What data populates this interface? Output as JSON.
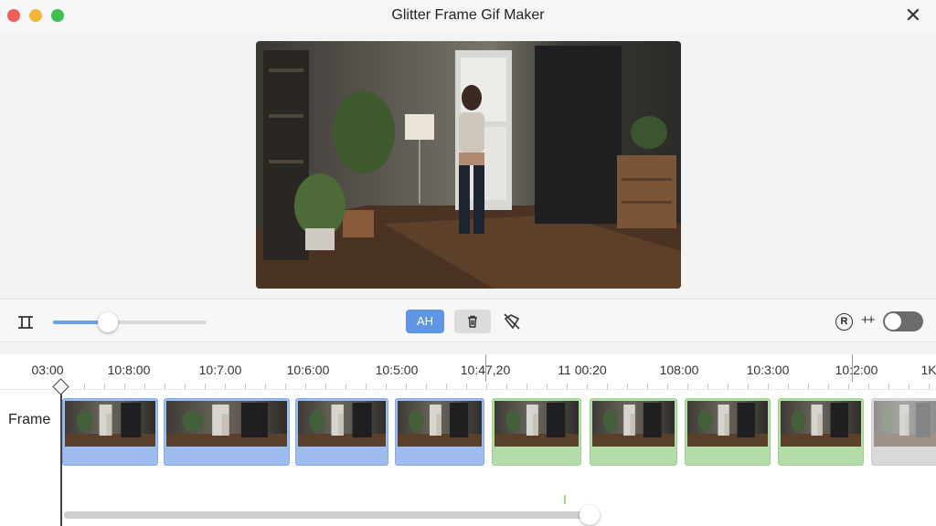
{
  "window": {
    "title": "Glitter Frame Gif Maker",
    "close_symbol": "✕"
  },
  "toolbar": {
    "ah_label": "AH",
    "zoom_level": 0.36,
    "r_icon_glyph": "R",
    "plus_label": "++",
    "toggle_on": false,
    "accent_color": "#5f95e3"
  },
  "timeline": {
    "track_label": "Frame",
    "ruler_labels": [
      "03:00",
      "10:8:00",
      "10:7.00",
      "10:6:00",
      "10:5:00",
      "10:47,20",
      "11 00:20",
      "108:00",
      "10:3:00",
      "10:2:00",
      "1K"
    ],
    "clips": [
      {
        "color": "blue"
      },
      {
        "color": "blue"
      },
      {
        "color": "blue"
      },
      {
        "color": "blue"
      },
      {
        "color": "green"
      },
      {
        "color": "green"
      },
      {
        "color": "green"
      },
      {
        "color": "green"
      },
      {
        "color": "gray"
      }
    ]
  }
}
